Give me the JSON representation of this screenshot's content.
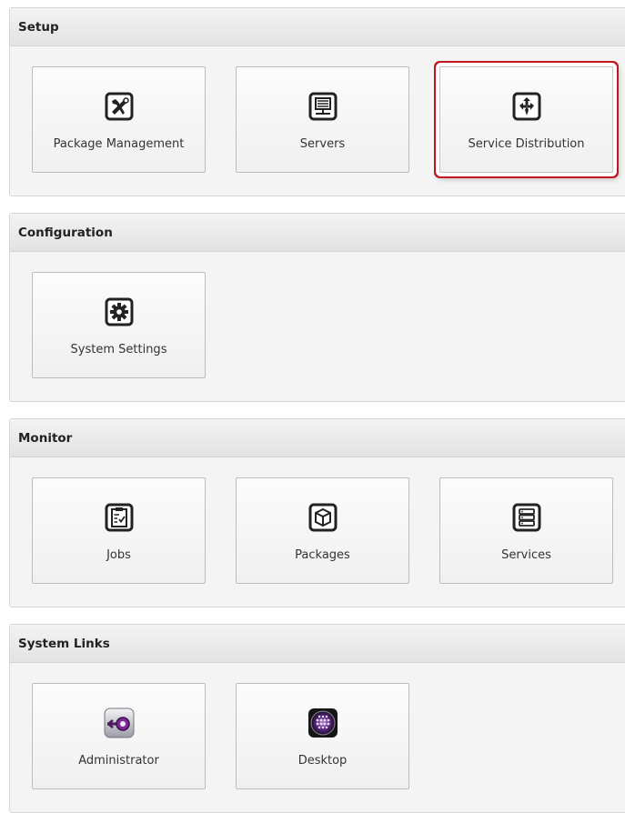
{
  "accent_color": "#c1181f",
  "sections": {
    "setup": {
      "title": "Setup",
      "tiles": [
        {
          "label": "Package Management",
          "icon": "tools-icon"
        },
        {
          "label": "Servers",
          "icon": "server-icon"
        },
        {
          "label": "Service Distribution",
          "icon": "distribution-icon",
          "selected": true
        }
      ]
    },
    "configuration": {
      "title": "Configuration",
      "tiles": [
        {
          "label": "System Settings",
          "icon": "gear-icon"
        }
      ]
    },
    "monitor": {
      "title": "Monitor",
      "tiles": [
        {
          "label": "Jobs",
          "icon": "clipboard-checklist-icon"
        },
        {
          "label": "Packages",
          "icon": "package-box-icon"
        },
        {
          "label": "Services",
          "icon": "stacked-list-icon"
        }
      ]
    },
    "system_links": {
      "title": "System Links",
      "tiles": [
        {
          "label": "Administrator",
          "icon": "administrator-key-icon"
        },
        {
          "label": "Desktop",
          "icon": "desktop-app-icon"
        }
      ]
    }
  }
}
